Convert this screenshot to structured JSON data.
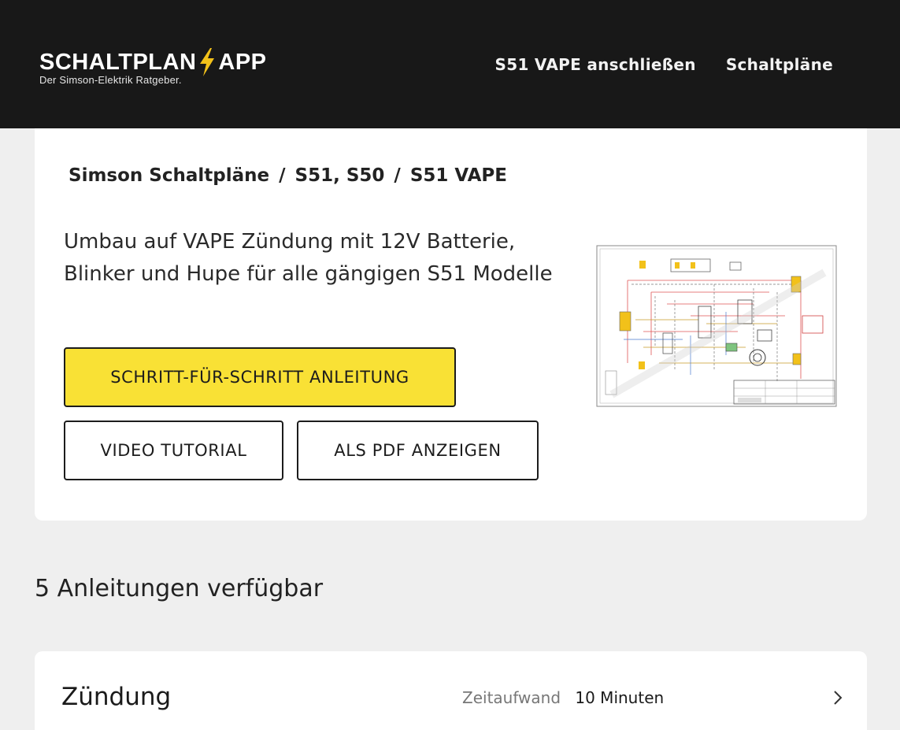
{
  "header": {
    "logo_left": "SCHALTPLAN",
    "logo_right": "APP",
    "tagline": "Der Simson-Elektrik Ratgeber.",
    "accent_color": "#f2c11a",
    "nav": [
      {
        "label": "S51 VAPE anschließen"
      },
      {
        "label": "Schaltpläne"
      }
    ]
  },
  "breadcrumb": {
    "items": [
      "Simson Schaltpläne",
      "S51, S50",
      "S51 VAPE"
    ],
    "separator": "/"
  },
  "main": {
    "description": "Umbau auf VAPE Zündung mit 12V Batterie, Blinker und Hupe für alle gängigen S51 Modelle",
    "buttons": {
      "primary": "SCHRITT-FÜR-SCHRITT ANLEITUNG",
      "video": "VIDEO TUTORIAL",
      "pdf": "ALS PDF ANZEIGEN"
    },
    "primary_color": "#f9e135"
  },
  "guides": {
    "count_label": "5 Anleitungen verfügbar",
    "items": [
      {
        "title": "Zündung",
        "time_label": "Zeitaufwand",
        "time_value": "10 Minuten"
      }
    ]
  }
}
